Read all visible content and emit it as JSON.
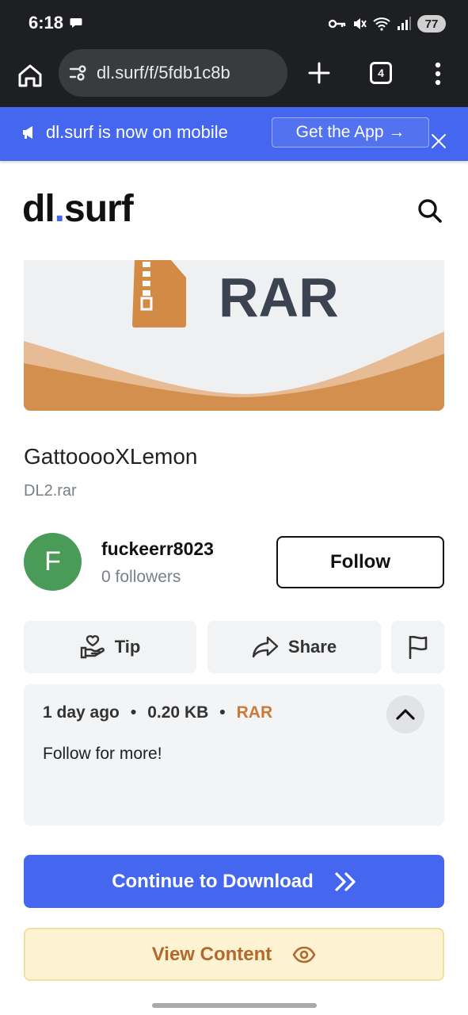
{
  "status_bar": {
    "time": "6:18",
    "battery": "77",
    "icons": [
      "message-icon",
      "vpn-key-icon",
      "mute-icon",
      "wifi-icon",
      "signal-icon",
      "battery-icon"
    ]
  },
  "browser": {
    "url": "dl.surf/f/5fdb1c8b",
    "tab_count": "4",
    "icons": [
      "home-icon",
      "site-settings-icon",
      "new-tab-plus-icon",
      "tabs-icon",
      "more-menu-icon"
    ]
  },
  "promo": {
    "text": "dl.surf is now on mobile",
    "button_label": "Get the App →"
  },
  "site": {
    "logo_part1": "dl",
    "logo_dot": ".",
    "logo_part2": "surf"
  },
  "file": {
    "thumbnail_label": "RAR",
    "title": "GattooooXLemon",
    "filename": "DL2.rar",
    "age": "1 day ago",
    "size": "0.20 KB",
    "type": "RAR",
    "separator": "•",
    "description": "Follow for more!"
  },
  "uploader": {
    "initial": "F",
    "name": "fuckeerr8023",
    "followers": "0 followers",
    "follow_label": "Follow"
  },
  "actions": {
    "tip_label": "Tip",
    "share_label": "Share"
  },
  "cta": {
    "download_label": "Continue to Download",
    "view_label": "View Content"
  },
  "colors": {
    "brand_blue": "#4566ee",
    "rar_orange": "#c97b3a",
    "avatar_green": "#4a9b57",
    "view_bg": "#fdf3d3"
  }
}
